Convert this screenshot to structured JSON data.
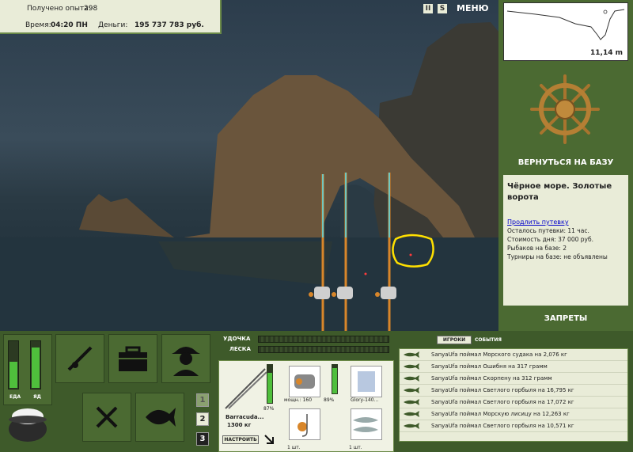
{
  "hud": {
    "exp_label": "Получено опыта:",
    "exp_value": "298",
    "time_label": "Время:",
    "time_value": "04:20 ПН",
    "money_label": "Деньги:",
    "money_value": "195 737 783 руб.",
    "menu_label": "МЕНЮ",
    "pause_label": "II",
    "sound_label": "S"
  },
  "depth": {
    "value": "11,14 m"
  },
  "base": {
    "return_label": "ВЕРНУТЬСЯ НА БАЗУ",
    "location_title": "Чёрное море. Золотые ворота",
    "extend_link": "Продлить путевку",
    "trip_left": "Осталось путевки: 11 час.",
    "day_cost": "Стоимость дня: 37 000 руб.",
    "anglers": "Рыбаков на базе: 2",
    "tournaments": "Турниры на базе: не объявлены",
    "bans_label": "ЗАПРЕТЫ"
  },
  "needs": {
    "food_label": "ЕДА",
    "poison_label": "ЯД",
    "food_level": 0.55,
    "poison_level": 0.85
  },
  "slots": {
    "one": "1",
    "two": "2",
    "three": "3"
  },
  "tackle": {
    "rod_label": "УДОЧКА",
    "line_label": "ЛЕСКА",
    "rod_name": "Barracuda...",
    "rod_load": "1300 кг",
    "rod_wear": "87%",
    "setup_btn": "НАСТРОИТЬ",
    "reel_power": "мощн.: 160",
    "reel_wear": "89%",
    "line_name": "Glory-140...",
    "hook_count": "1 шт.",
    "bait_count": "1 шт."
  },
  "chat": {
    "tab_players": "ИГРОКИ",
    "tab_events": "СОБЫТИЯ",
    "messages": [
      "SanyaUfa поймал Морского судака на 2,076 кг",
      "SanyaUfa поймал Ошибня на 317 грамм",
      "SanyaUfa поймал Скорпену на 312 грамм",
      "SanyaUfa поймал Светлого горбыля на 16,795 кг",
      "SanyaUfa поймал Светлого горбыля на 17,072 кг",
      "SanyaUfa поймал Морскую лисицу на 12,263 кг",
      "SanyaUfa поймал Светлого горбыля на 10,571 кг"
    ]
  },
  "colors": {
    "panel": "#4b6a32",
    "cream": "#e9ecd8",
    "highlight": "#ffe000"
  }
}
